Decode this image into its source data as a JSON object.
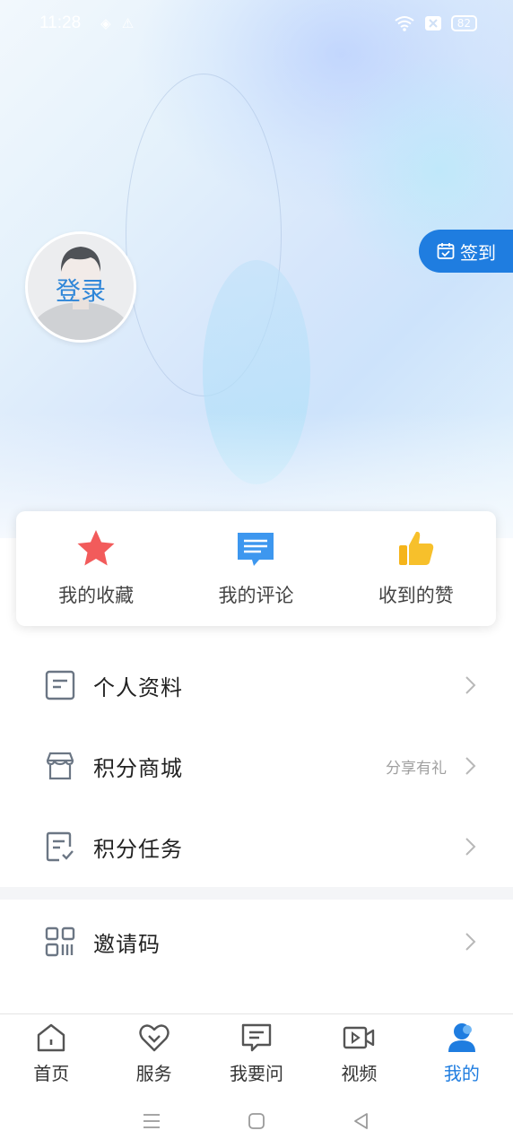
{
  "status_bar": {
    "time": "11:28",
    "battery": "82",
    "icons": [
      "location-icon",
      "warning-icon",
      "wifi-icon",
      "sim-off-icon",
      "battery-icon"
    ]
  },
  "profile": {
    "login_label": "登录",
    "sign_in_label": "签到"
  },
  "quick_actions": [
    {
      "label": "我的收藏",
      "icon": "star-icon"
    },
    {
      "label": "我的评论",
      "icon": "comment-icon"
    },
    {
      "label": "收到的赞",
      "icon": "thumbs-up-icon"
    }
  ],
  "menu": [
    {
      "label": "个人资料",
      "icon": "document-icon",
      "extra": ""
    },
    {
      "label": "积分商城",
      "icon": "store-icon",
      "extra": "分享有礼"
    },
    {
      "label": "积分任务",
      "icon": "task-icon",
      "extra": ""
    },
    {
      "label": "邀请码",
      "icon": "qr-code-icon",
      "extra": ""
    }
  ],
  "tabs": [
    {
      "label": "首页",
      "icon": "home-icon",
      "active": false
    },
    {
      "label": "服务",
      "icon": "heart-icon",
      "active": false
    },
    {
      "label": "我要问",
      "icon": "message-icon",
      "active": false
    },
    {
      "label": "视频",
      "icon": "video-icon",
      "active": false
    },
    {
      "label": "我的",
      "icon": "user-icon",
      "active": true
    }
  ],
  "colors": {
    "accent": "#1f7de0",
    "star": "#f25b5b",
    "comment": "#3d97ef",
    "thumb": "#f5b41a",
    "icon_gray": "#6b7684"
  }
}
